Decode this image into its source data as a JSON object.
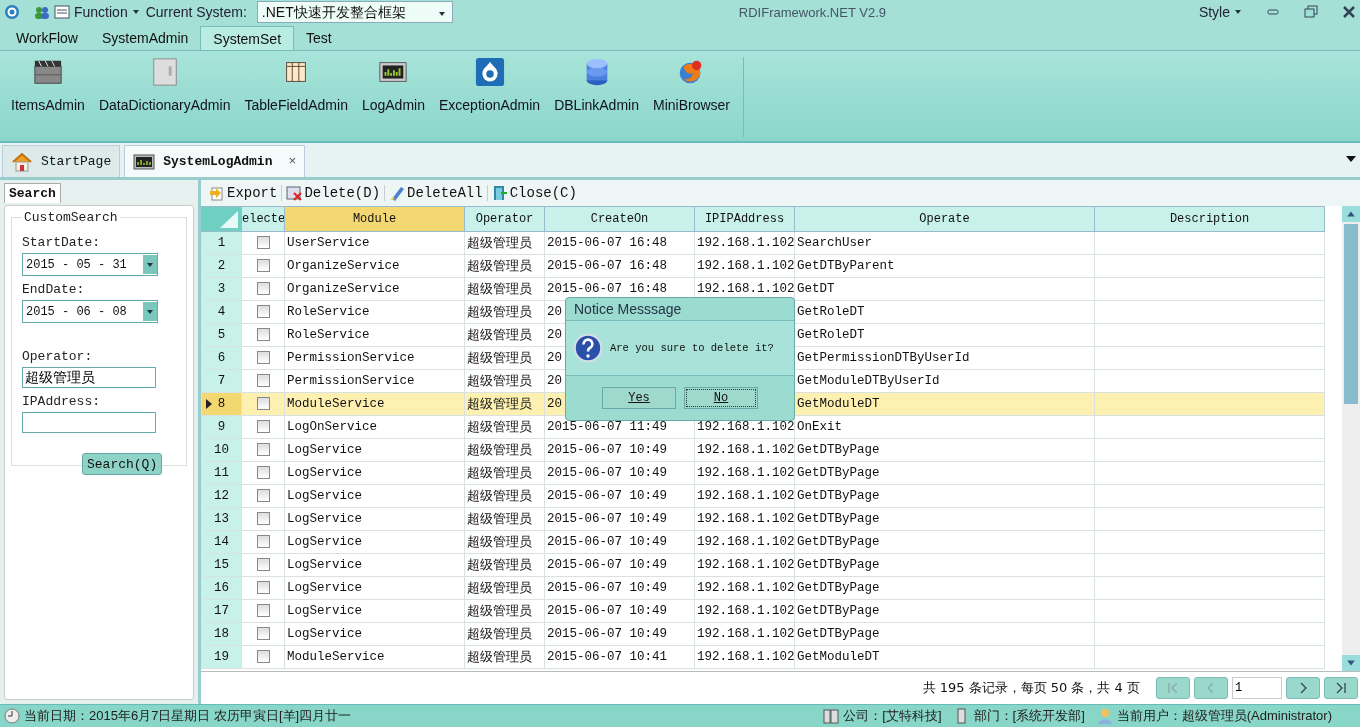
{
  "titlebar": {
    "menu_function": "Function",
    "current_system_label": "Current System:",
    "current_system": ".NET快速开发整合框架",
    "title": "RDIFramework.NET V2.9",
    "style_menu": "Style"
  },
  "ribbon_tabs": [
    {
      "label": "WorkFlow",
      "selected": false
    },
    {
      "label": "SystemAdmin",
      "selected": false
    },
    {
      "label": "SystemSet",
      "selected": true
    },
    {
      "label": "Test",
      "selected": false
    }
  ],
  "ribbon_buttons": [
    "ItemsAdmin",
    "DataDictionaryAdmin",
    "TableFieldAdmin",
    "LogAdmin",
    "ExceptionAdmin",
    "DBLinkAdmin",
    "MiniBrowser"
  ],
  "doc_tabs": [
    {
      "label": "StartPage",
      "selected": false
    },
    {
      "label": "SystemLogAdmin",
      "selected": true,
      "close": "×"
    }
  ],
  "search_panel": {
    "tab": "Search",
    "group": "CustomSearch",
    "start_label": "StartDate:",
    "start_value": "2015 - 05 - 31",
    "end_label": "EndDate:",
    "end_value": "2015 - 06 - 08",
    "operator_label": "Operator:",
    "operator_value": "超级管理员",
    "ip_label": "IPAddress:",
    "search_button": "Search(Q)"
  },
  "toolbar": [
    "Export",
    "Delete(D)",
    "DeleteAll",
    "Close(C)"
  ],
  "table": {
    "columns": [
      {
        "label": "electe",
        "highlighted": false
      },
      {
        "label": "Module",
        "highlighted": true
      },
      {
        "label": "Operator",
        "highlighted": false
      },
      {
        "label": "CreateOn",
        "highlighted": false
      },
      {
        "label": "IPIPAddress",
        "highlighted": false
      },
      {
        "label": "Operate",
        "highlighted": false
      },
      {
        "label": "Description",
        "highlighted": false
      }
    ],
    "rows": [
      {
        "no": "1",
        "checked": false,
        "selected": false,
        "module": "UserService",
        "operator": "超级管理员",
        "created": "2015-06-07 16:48",
        "ip": "192.168.1.102",
        "operate": "SearchUser"
      },
      {
        "no": "2",
        "checked": false,
        "selected": false,
        "module": "OrganizeService",
        "operator": "超级管理员",
        "created": "2015-06-07 16:48",
        "ip": "192.168.1.102",
        "operate": "GetDTByParent"
      },
      {
        "no": "3",
        "checked": false,
        "selected": false,
        "module": "OrganizeService",
        "operator": "超级管理员",
        "created": "2015-06-07 16:48",
        "ip": "192.168.1.102",
        "operate": "GetDT"
      },
      {
        "no": "4",
        "checked": false,
        "selected": false,
        "module": "RoleService",
        "operator": "超级管理员",
        "created": "20",
        "operate": "GetRoleDT"
      },
      {
        "no": "5",
        "checked": false,
        "selected": false,
        "module": "RoleService",
        "operator": "超级管理员",
        "created": "20",
        "operate": "GetRoleDT"
      },
      {
        "no": "6",
        "checked": false,
        "selected": false,
        "module": "PermissionService",
        "operator": "超级管理员",
        "created": "20",
        "operate": "GetPermissionDTByUserId"
      },
      {
        "no": "7",
        "checked": false,
        "selected": false,
        "module": "PermissionService",
        "operator": "超级管理员",
        "created": "20",
        "operate": "GetModuleDTByUserId"
      },
      {
        "no": "8",
        "checked": false,
        "selected": true,
        "module": "ModuleService",
        "operator": "超级管理员",
        "created": "20",
        "operate": "GetModuleDT"
      },
      {
        "no": "9",
        "checked": false,
        "selected": false,
        "module": "LogOnService",
        "operator": "超级管理员",
        "created": "2015-06-07 11:49",
        "ip": "192.168.1.102",
        "operate": "OnExit"
      },
      {
        "no": "10",
        "checked": false,
        "selected": false,
        "module": "LogService",
        "operator": "超级管理员",
        "created": "2015-06-07 10:49",
        "ip": "192.168.1.102",
        "operate": "GetDTByPage"
      },
      {
        "no": "11",
        "checked": false,
        "selected": false,
        "module": "LogService",
        "operator": "超级管理员",
        "created": "2015-06-07 10:49",
        "ip": "192.168.1.102",
        "operate": "GetDTByPage"
      },
      {
        "no": "12",
        "checked": false,
        "selected": false,
        "module": "LogService",
        "operator": "超级管理员",
        "created": "2015-06-07 10:49",
        "ip": "192.168.1.102",
        "operate": "GetDTByPage"
      },
      {
        "no": "13",
        "checked": false,
        "selected": false,
        "module": "LogService",
        "operator": "超级管理员",
        "created": "2015-06-07 10:49",
        "ip": "192.168.1.102",
        "operate": "GetDTByPage"
      },
      {
        "no": "14",
        "checked": false,
        "selected": false,
        "module": "LogService",
        "operator": "超级管理员",
        "created": "2015-06-07 10:49",
        "ip": "192.168.1.102",
        "operate": "GetDTByPage"
      },
      {
        "no": "15",
        "checked": false,
        "selected": false,
        "module": "LogService",
        "operator": "超级管理员",
        "created": "2015-06-07 10:49",
        "ip": "192.168.1.102",
        "operate": "GetDTByPage"
      },
      {
        "no": "16",
        "checked": false,
        "selected": false,
        "module": "LogService",
        "operator": "超级管理员",
        "created": "2015-06-07 10:49",
        "ip": "192.168.1.102",
        "operate": "GetDTByPage"
      },
      {
        "no": "17",
        "checked": false,
        "selected": false,
        "module": "LogService",
        "operator": "超级管理员",
        "created": "2015-06-07 10:49",
        "ip": "192.168.1.102",
        "operate": "GetDTByPage"
      },
      {
        "no": "18",
        "checked": false,
        "selected": false,
        "module": "LogService",
        "operator": "超级管理员",
        "created": "2015-06-07 10:49",
        "ip": "192.168.1.102",
        "operate": "GetDTByPage"
      },
      {
        "no": "19",
        "checked": false,
        "selected": false,
        "module": "ModuleService",
        "operator": "超级管理员",
        "created": "2015-06-07 10:41",
        "ip": "192.168.1.102",
        "operate": "GetModuleDT"
      }
    ]
  },
  "pager": {
    "summary": "共 195 条记录，每页 50 条，共 4 页",
    "page": "1"
  },
  "dialog": {
    "title": "Notice Messsage",
    "message": "Are you sure to delete it?",
    "buttons": [
      {
        "label": "Yes",
        "focused": false
      },
      {
        "label": "No",
        "focused": true
      }
    ]
  },
  "status_bar": {
    "date": "当前日期：2015年6月7日星期日 农历甲寅日[羊]四月廿一",
    "company": "公司：[艾特科技]",
    "department": "部门：[系统开发部]",
    "user": "当前用户：超级管理员(Administrator)"
  }
}
